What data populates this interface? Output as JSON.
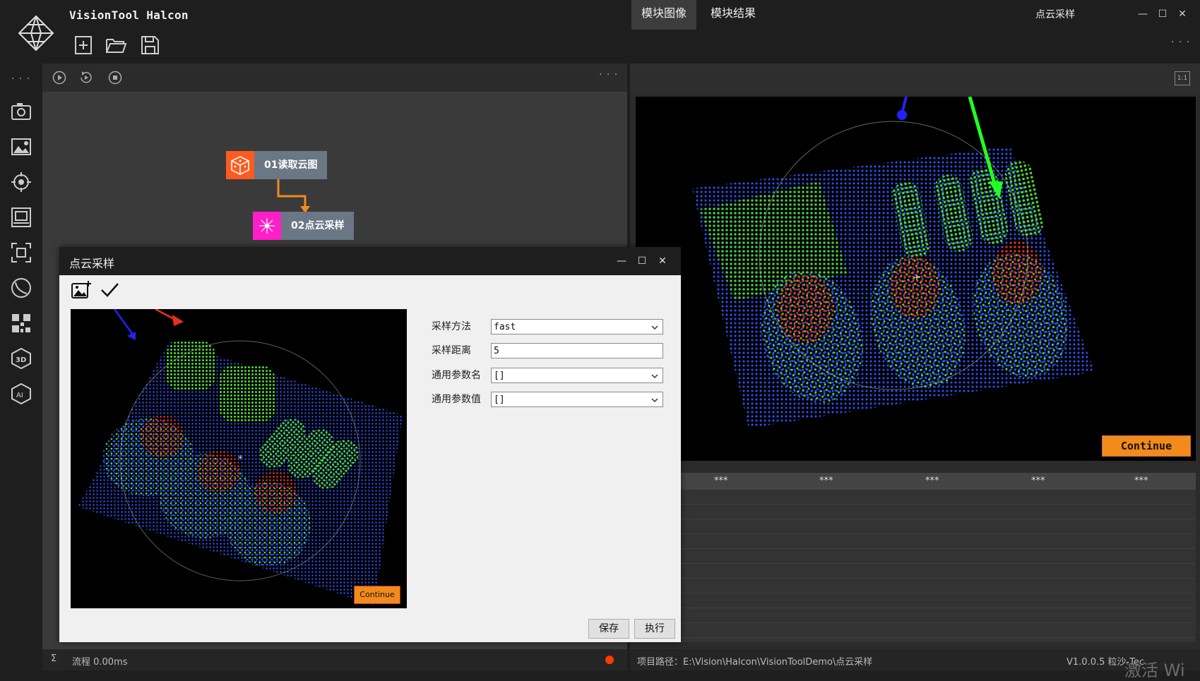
{
  "app": {
    "title": "VisionTool Halcon",
    "window_title": "点云采样",
    "toolbar": {
      "new_icon": "new-file-icon",
      "open_icon": "open-folder-icon",
      "save_icon": "save-icon"
    },
    "window_controls": [
      "—",
      "☐",
      "✕"
    ],
    "more": "· · ·"
  },
  "sidebar": {
    "more": "· · ·",
    "items": [
      "camera-icon",
      "image-settings-icon",
      "target-icon",
      "gallery-icon",
      "focus-icon",
      "curve-icon",
      "qr-code-icon",
      "3d-icon",
      "ai-icon"
    ]
  },
  "flow": {
    "toolbar": [
      "play-icon",
      "loop-icon",
      "stop-icon"
    ],
    "more": "· · ·",
    "nodes": [
      {
        "label": "01读取云图",
        "color": "#ff5a1f",
        "icon": "dice-icon"
      },
      {
        "label": "02点云采样",
        "color": "#ff1ec8",
        "icon": "sparkle-icon"
      }
    ]
  },
  "right": {
    "tabs": [
      "模块图像",
      "模块结果"
    ],
    "ratio_button": "1:1",
    "continue_label": "Continue",
    "results_header": [
      "***",
      "***",
      "***",
      "***",
      "***"
    ]
  },
  "dialog": {
    "title": "点云采样",
    "window_controls": [
      "—",
      "☐",
      "✕"
    ],
    "continue_label": "Continue",
    "params": [
      {
        "label": "采样方法",
        "value": "fast",
        "dropdown": true
      },
      {
        "label": "采样距离",
        "value": "5",
        "dropdown": false
      },
      {
        "label": "通用参数名",
        "value": "[]",
        "dropdown": true
      },
      {
        "label": "通用参数值",
        "value": "[]",
        "dropdown": true
      }
    ],
    "buttons": {
      "save": "保存",
      "run": "执行"
    }
  },
  "status": {
    "sigma": "Σ",
    "flow_time": "流程  0.00ms",
    "project_path": "项目路径：E:\\Vision\\Halcon\\VisionToolDemo\\点云采样",
    "version": "V1.0.0.5 粒沙-Tec",
    "watermark": "激活 Wi"
  },
  "colors": {
    "accent_orange": "#f28a1c",
    "status_dot": "#ff3d00"
  }
}
